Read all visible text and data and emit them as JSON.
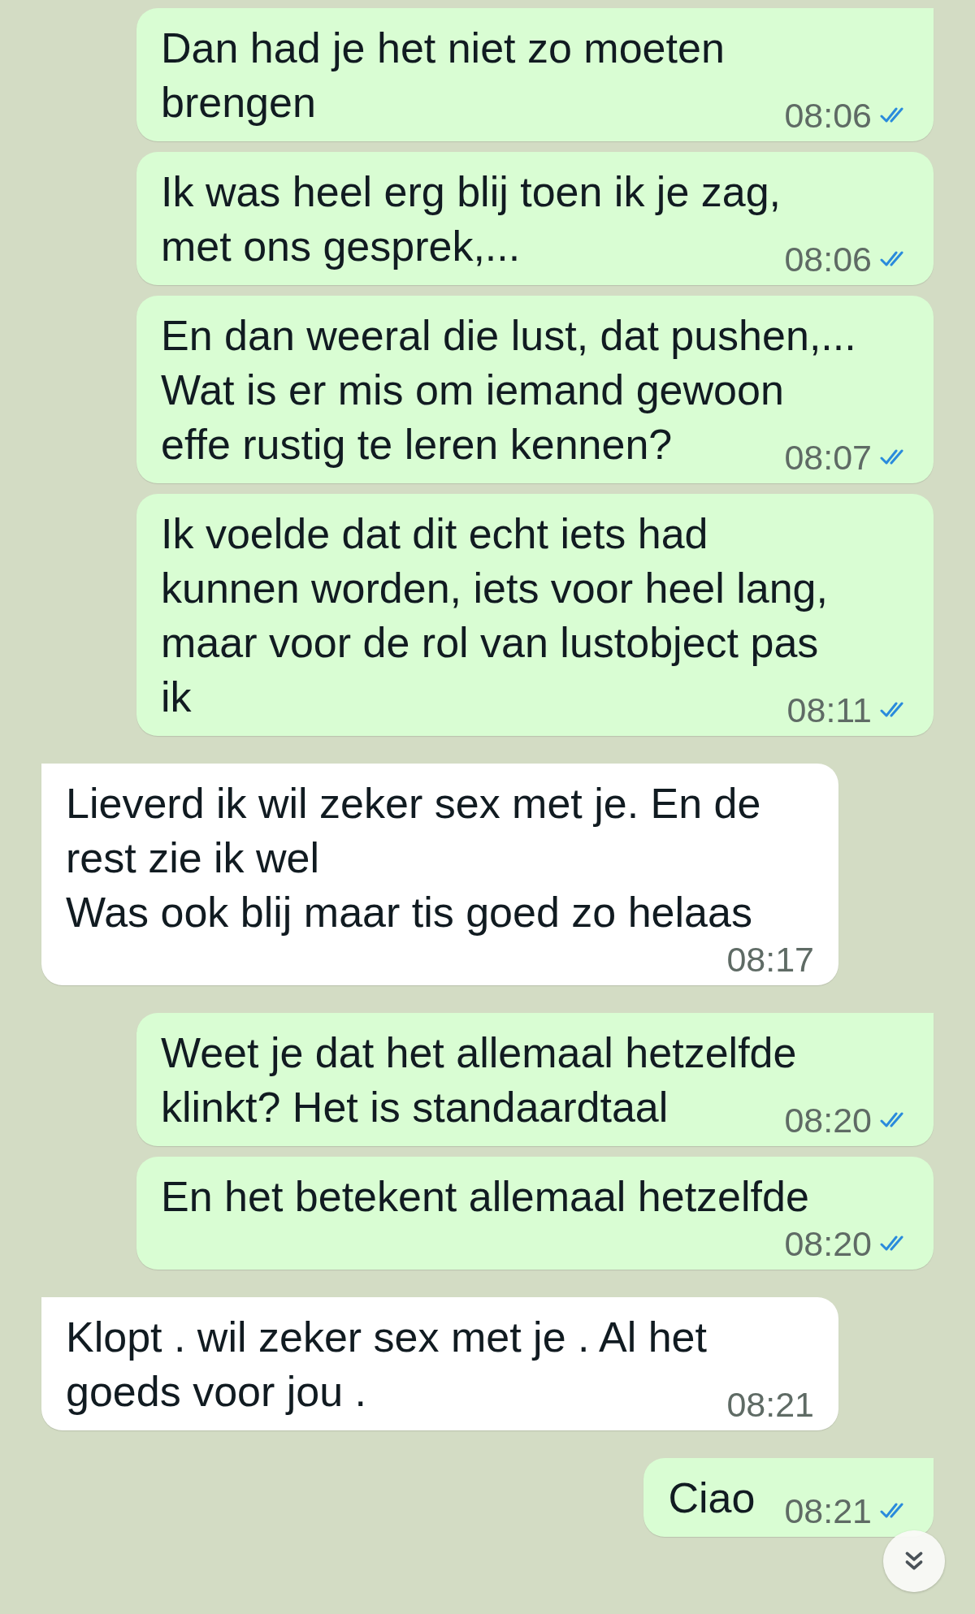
{
  "messages": [
    {
      "outgoing": true,
      "lines": [
        "Dan had je het niet zo moeten",
        "brengen"
      ],
      "time": "08:06",
      "read": true
    },
    {
      "outgoing": true,
      "lines": [
        "Ik was heel erg blij toen ik je zag,",
        "met ons gesprek,..."
      ],
      "time": "08:06",
      "read": true
    },
    {
      "outgoing": true,
      "lines": [
        "En dan weeral die lust, dat pushen,...",
        "Wat is er mis om iemand gewoon",
        "effe rustig te leren kennen?"
      ],
      "time": "08:07",
      "read": true
    },
    {
      "outgoing": true,
      "lines": [
        "Ik voelde dat dit echt iets had",
        "kunnen worden, iets voor heel lang,",
        "maar voor de rol van lustobject pas",
        "ik"
      ],
      "time": "08:11",
      "read": true
    },
    {
      "outgoing": false,
      "lines": [
        "Lieverd ik wil zeker sex met je. En de",
        "rest zie ik wel",
        "Was ook blij maar tis goed zo helaas"
      ],
      "time": "08:17"
    },
    {
      "outgoing": true,
      "lines": [
        "Weet je dat het allemaal hetzelfde",
        "klinkt? Het is standaardtaal"
      ],
      "time": "08:20",
      "read": true
    },
    {
      "outgoing": true,
      "lines": [
        "En het betekent allemaal hetzelfde"
      ],
      "time": "08:20",
      "read": true
    },
    {
      "outgoing": false,
      "lines": [
        "Klopt . wil zeker sex met je  . Al het",
        "goeds voor jou ."
      ],
      "time": "08:21"
    },
    {
      "outgoing": true,
      "lines": [
        "Ciao"
      ],
      "time": "08:21",
      "read": true
    }
  ]
}
